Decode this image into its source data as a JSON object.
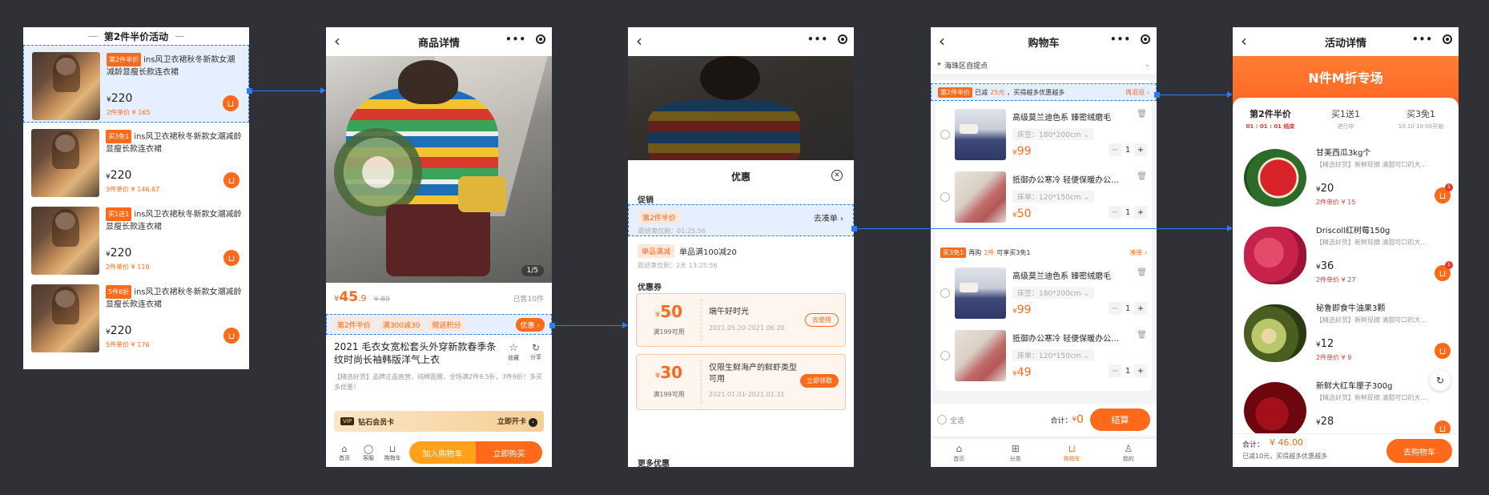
{
  "screen1": {
    "title": "第2件半价活动",
    "products": [
      {
        "tag": "第2件半价",
        "name": "ins风卫衣裙秋冬新款女潮减龄显瘦长款连衣裙",
        "price": "220",
        "promo": "2件单价 ¥ 165"
      },
      {
        "tag": "买3免1",
        "name": "ins风卫衣裙秋冬新款女潮减龄显瘦长款连衣裙",
        "price": "220",
        "promo": "3件单价 ¥ 146.67"
      },
      {
        "tag": "买1送1",
        "name": "ins风卫衣裙秋冬新款女潮减龄显瘦长款连衣裙",
        "price": "220",
        "promo": "2件单价 ¥ 110"
      },
      {
        "tag": "5件8折",
        "name": "ins风卫衣裙秋冬新款女潮减龄显瘦长款连衣裙",
        "price": "220",
        "promo": "5件单价 ¥ 176"
      }
    ]
  },
  "screen2": {
    "title": "商品详情",
    "image_counter": "1/5",
    "price_int": "45",
    "price_dec": ".9",
    "orig_price": "¥ 89",
    "sold": "已售10件",
    "promo_tags": [
      "第2件半价",
      "满300减30",
      "赠送积分"
    ],
    "promo_btn": "优惠",
    "product_title": "2021 毛衣女宽松套头外穿新款春季条纹时尚长袖韩版洋气上衣",
    "fav_label": "收藏",
    "share_label": "分享",
    "desc": "【精选好货】品牌正品直营，纯棉面膜，全场满2件9.5折，3件9折！多买多优惠！",
    "vip_badge": "VIP",
    "vip_label": "钻石会员卡",
    "vip_action": "立即开卡",
    "nav": [
      "首页",
      "客服",
      "购物车"
    ],
    "add_cart": "加入购物车",
    "buy_now": "立即购买"
  },
  "screen3": {
    "sheet_title": "优惠",
    "promo_section": "促销",
    "promo1_tag": "第2件半价",
    "promo1_action": "去凑单",
    "promo1_time": "距结束仅剩：01:25:56",
    "promo2_tag": "单品满减",
    "promo2_text": "单品满100减20",
    "promo2_time": "距结束仅剩：2天 13:25:56",
    "coupon_section": "优惠券",
    "coupons": [
      {
        "amount": "50",
        "cond": "满199可用",
        "title": "端午好时光",
        "date": "2021.05.20-2021.06.20",
        "btn": "去使用"
      },
      {
        "amount": "30",
        "cond": "满199可用",
        "title": "仅限生鲜海产的鲜虾类型可用",
        "date": "2021.01.01-2021.01.31",
        "btn": "立即领取"
      }
    ],
    "more": "更多优惠"
  },
  "screen4": {
    "title": "购物车",
    "location": "海珠区自提点",
    "banner_tag": "第2件半价",
    "banner_text_pre": "已减",
    "banner_amount": "25元",
    "banner_text_post": "，买得越多优惠越多",
    "banner_action": "再逛逛",
    "group2_tag": "买3免1",
    "group2_text_pre": "再购",
    "group2_count": "1件",
    "group2_text_post": "可享买3免1",
    "group2_action": "凑单",
    "items": [
      {
        "name": "高级莫兰迪色系  臻密绒磨毛",
        "spec": "床笠：180*200cm",
        "price": "99",
        "qty": "1"
      },
      {
        "name": "抵御办公寒冷 轻便保暖办公…",
        "spec": "床单：120*150cm",
        "price": "50",
        "qty": "1"
      },
      {
        "name": "高级莫兰迪色系  臻密绒磨毛",
        "spec": "床笠：180*200cm",
        "price": "99",
        "qty": "1"
      },
      {
        "name": "抵御办公寒冷 轻便保暖办公…",
        "spec": "床单：120*150cm",
        "price": "49",
        "qty": "1"
      }
    ],
    "select_all": "全选",
    "total_label": "合计：",
    "total": "0",
    "checkout": "结算",
    "tabs": [
      "首页",
      "分类",
      "购物车",
      "我的"
    ]
  },
  "screen5": {
    "title": "活动详情",
    "hero": "N件M折专场",
    "tabs": [
      {
        "name": "第2件半价",
        "sub": "01 : 01 : 01 结束"
      },
      {
        "name": "买1送1",
        "sub": "进行中"
      },
      {
        "name": "买3免1",
        "sub": "10.10 10:00开始"
      }
    ],
    "products": [
      {
        "name": "甘美西瓜3kg个",
        "desc": "【精选好货】新鲜现摘 清甜可口的大...",
        "price": "20",
        "promo": "2件单价 ¥ 15",
        "badge": "1"
      },
      {
        "name": "Driscoll红树莓150g",
        "desc": "【精选好货】新鲜现摘 清甜可口的大...",
        "price": "36",
        "promo": "2件单价 ¥ 27",
        "badge": "1"
      },
      {
        "name": "秘鲁即食牛油果3颗",
        "desc": "【精选好货】新鲜现摘 清甜可口的大...",
        "price": "12",
        "promo": "2件单价 ¥ 9",
        "badge": ""
      },
      {
        "name": "新鲜大红车厘子300g",
        "desc": "【精选好货】新鲜现摘 清甜可口的大...",
        "price": "28",
        "promo": "",
        "badge": ""
      }
    ],
    "total_label": "合计：",
    "total": "¥ 46.00",
    "saved": "已减10元，买得越多优惠越多",
    "go_cart": "去购物车"
  }
}
